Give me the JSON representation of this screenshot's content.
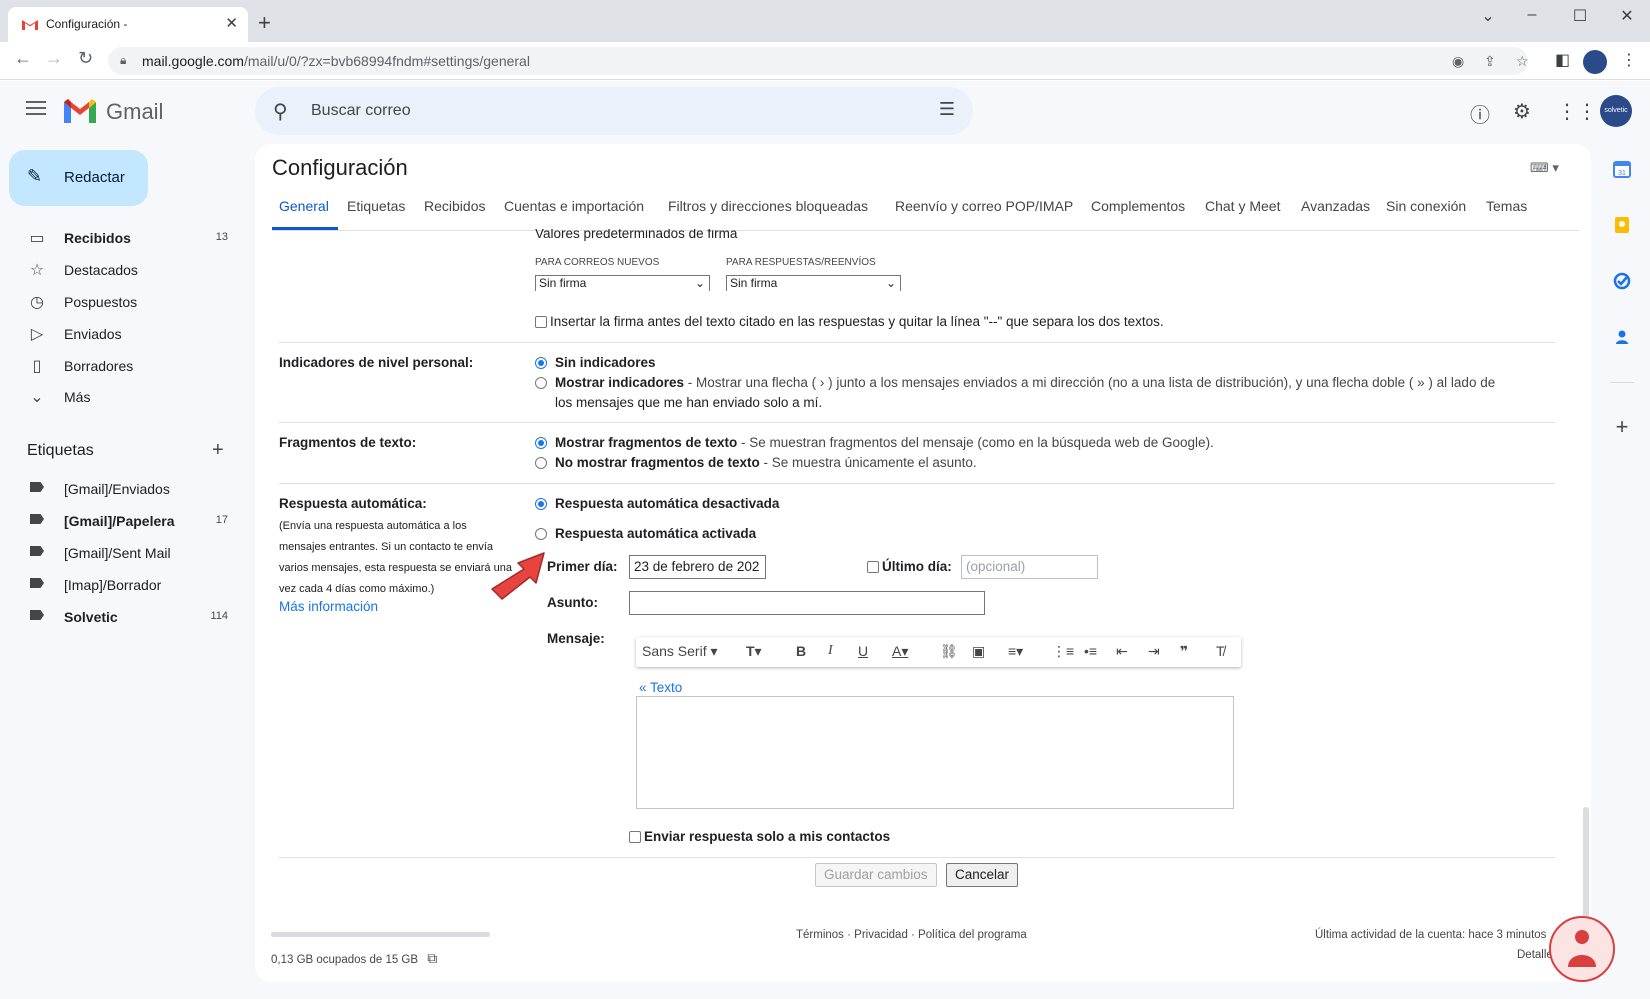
{
  "browser": {
    "tab_title": "Configuración -",
    "tab_close": "✕",
    "new_tab": "+",
    "url_host": "mail.google.com",
    "url_path": "/mail/u/0/?zx=bvb68994fndm#settings/general",
    "window_controls": [
      "⌄",
      "–",
      "☐",
      "✕"
    ]
  },
  "gmail": {
    "product_name": "Gmail",
    "search_placeholder": "Buscar correo",
    "avatar_text": "solvetic",
    "compose_label": "Redactar",
    "nav": [
      {
        "label": "Recibidos",
        "count": "13",
        "icon": "inbox-icon",
        "bold": true
      },
      {
        "label": "Destacados",
        "count": "",
        "icon": "star-icon",
        "bold": false
      },
      {
        "label": "Pospuestos",
        "count": "",
        "icon": "clock-icon",
        "bold": false
      },
      {
        "label": "Enviados",
        "count": "",
        "icon": "send-icon",
        "bold": false
      },
      {
        "label": "Borradores",
        "count": "",
        "icon": "draft-icon",
        "bold": false
      },
      {
        "label": "Más",
        "count": "",
        "icon": "chevron-down-icon",
        "bold": false
      }
    ],
    "labels_title": "Etiquetas",
    "labels": [
      {
        "label": "[Gmail]/Enviados",
        "count": "",
        "bold": false
      },
      {
        "label": "[Gmail]/Papelera",
        "count": "17",
        "bold": true
      },
      {
        "label": "[Gmail]/Sent Mail",
        "count": "",
        "bold": false
      },
      {
        "label": "[Imap]/Borrador",
        "count": "",
        "bold": false
      },
      {
        "label": "Solvetic",
        "count": "114",
        "bold": true
      }
    ]
  },
  "settings": {
    "title": "Configuración",
    "tabs": [
      "General",
      "Etiquetas",
      "Recibidos",
      "Cuentas e importación",
      "Filtros y direcciones bloqueadas",
      "Reenvío y correo POP/IMAP",
      "Complementos",
      "Chat y Meet",
      "Avanzadas",
      "Sin conexión",
      "Temas"
    ],
    "signature": {
      "heading": "Valores predeterminados de firma",
      "new_label": "PARA CORREOS NUEVOS",
      "reply_label": "PARA RESPUESTAS/REENVÍOS",
      "new_value": "Sin firma",
      "reply_value": "Sin firma",
      "insert_before": "Insertar la firma antes del texto citado en las respuestas y quitar la línea \"--\" que separa los dos textos."
    },
    "personal_indicators": {
      "label": "Indicadores de nivel personal:",
      "opt1": "Sin indicadores",
      "opt2_bold": "Mostrar indicadores",
      "opt2_desc_line1": " - Mostrar una flecha ( › ) junto a los mensajes enviados a mi dirección (no a una lista de distribución), y una flecha doble ( » ) al lado de",
      "opt2_desc_line2": "los mensajes que me han enviado solo a mí."
    },
    "snippets": {
      "label": "Fragmentos de texto:",
      "opt1_bold": "Mostrar fragmentos de texto",
      "opt1_desc": " - Se muestran fragmentos del mensaje (como en la búsqueda web de Google).",
      "opt2_bold": "No mostrar fragmentos de texto",
      "opt2_desc": " - Se muestra únicamente el asunto."
    },
    "autoreply": {
      "label": "Respuesta automática:",
      "desc_lines": [
        "(Envía una respuesta automática a los",
        "mensajes entrantes. Si un contacto te envía",
        "varios mensajes, esta respuesta se enviará una",
        "vez cada 4 días como máximo.)"
      ],
      "more_info": "Más información",
      "off": "Respuesta automática desactivada",
      "on": "Respuesta automática activada",
      "first_day_label": "Primer día:",
      "first_day_value": "23 de febrero de 202",
      "last_day_label": "Último día:",
      "last_day_placeholder": "(opcional)",
      "subject_label": "Asunto:",
      "subject_value": "",
      "message_label": "Mensaje:",
      "font_name": "Sans Serif",
      "texto_link": "« Texto",
      "contacts_only": "Enviar respuesta solo a mis contactos"
    },
    "save_label": "Guardar cambios",
    "cancel_label": "Cancelar"
  },
  "footer": {
    "quota": "0,13 GB ocupados de 15 GB",
    "links": "Términos · Privacidad · Política del programa",
    "last_activity": "Última actividad de la cuenta: hace 3 minutos",
    "details": "Detalles"
  },
  "colors": {
    "accent": "#0b57d0",
    "compose_bg": "#c2e7ff",
    "app_bg": "#f6f8fc",
    "arrow": "#e8443f"
  }
}
